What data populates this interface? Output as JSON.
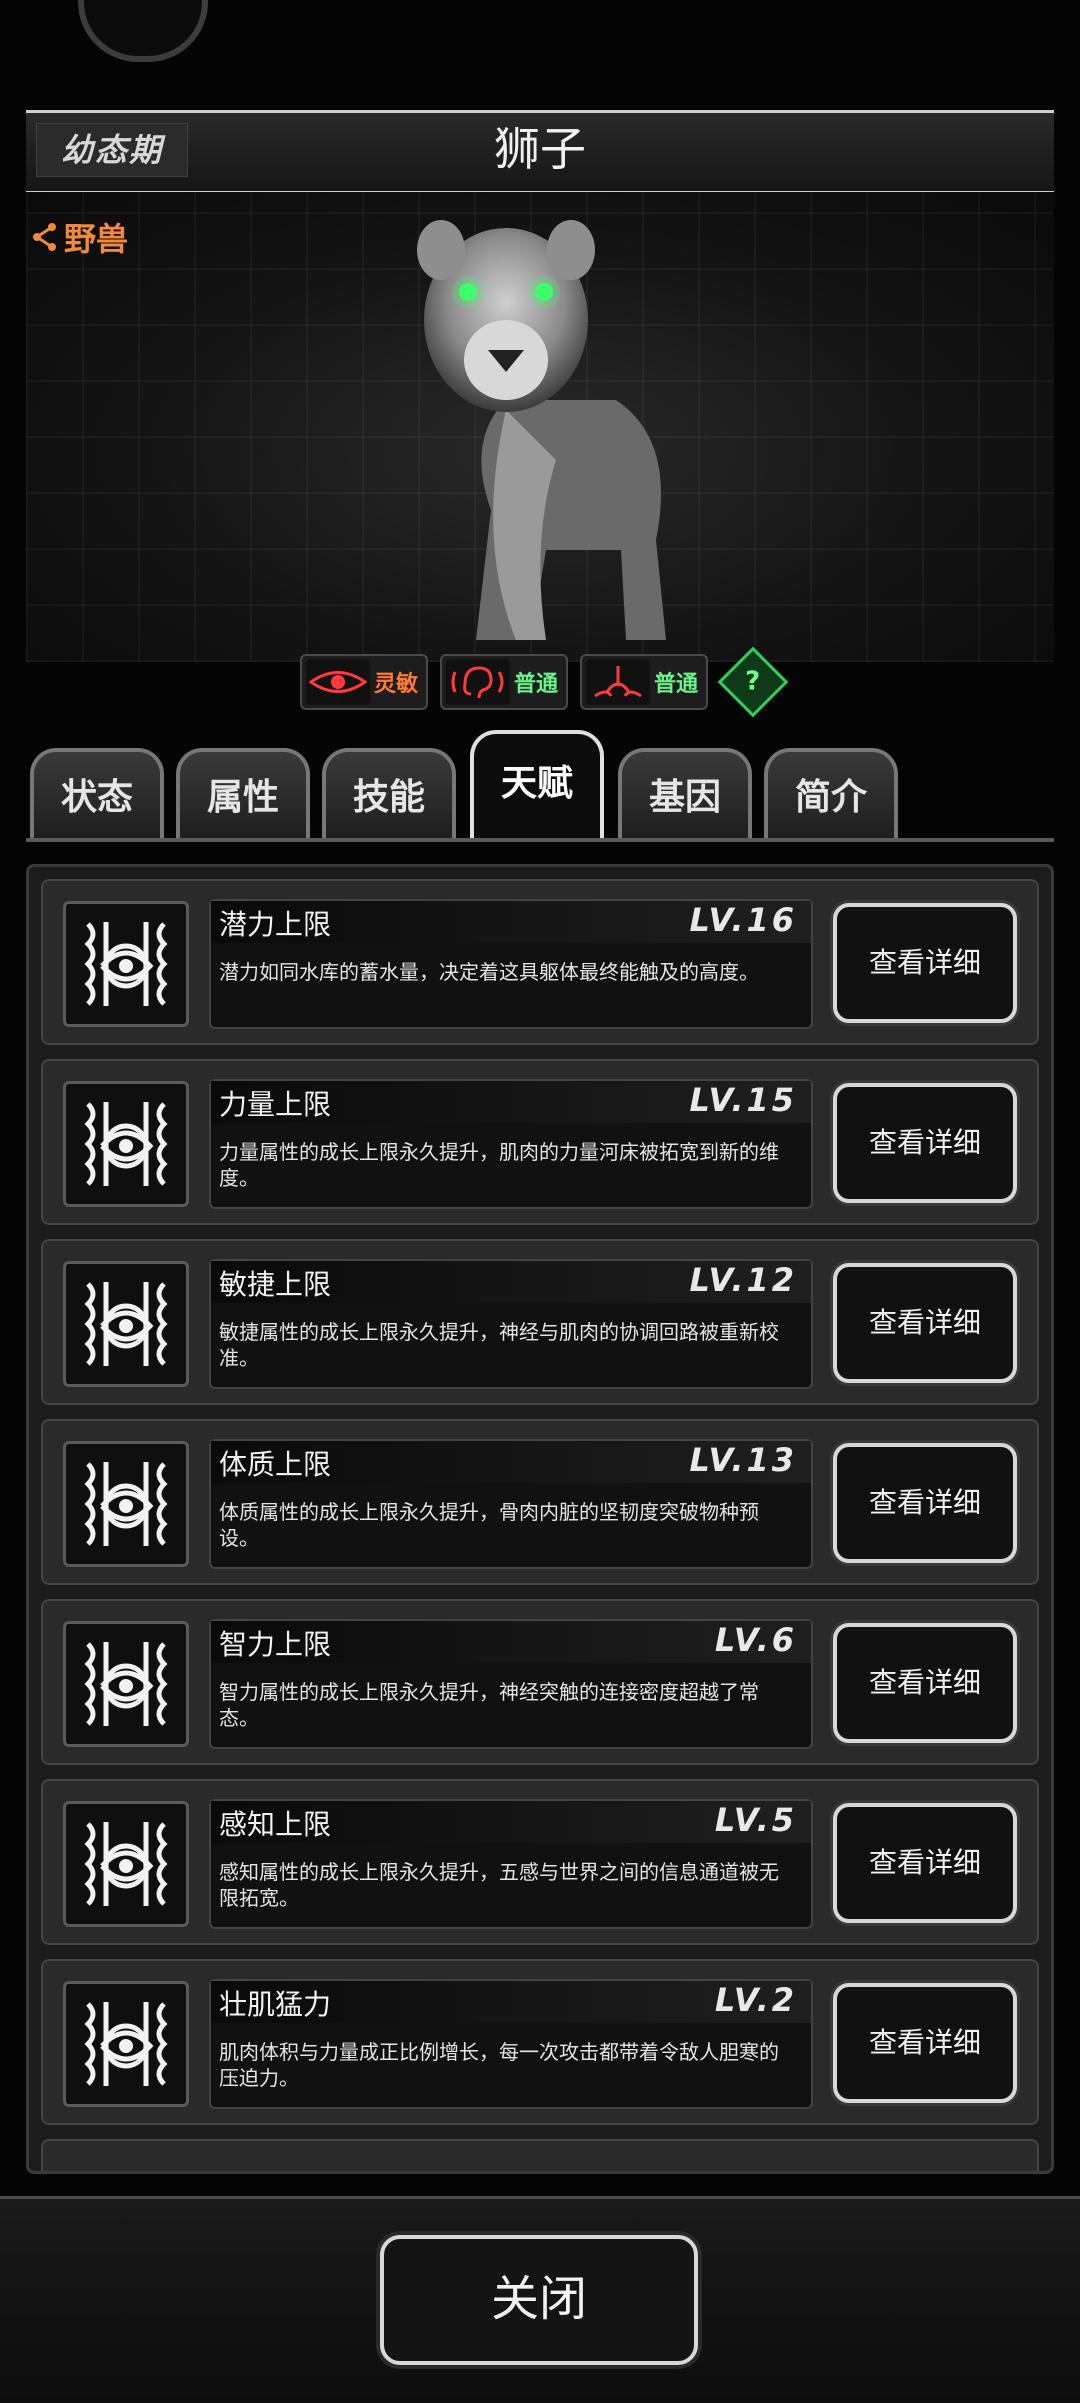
{
  "header": {
    "stage": "幼态期",
    "title": "狮子"
  },
  "creature": {
    "type_label": "野兽",
    "senses": [
      {
        "label": "灵敏",
        "icon": "eye-icon",
        "color": "#ff7a3a"
      },
      {
        "label": "普通",
        "icon": "ear-icon",
        "color": "#6cf08a"
      },
      {
        "label": "普通",
        "icon": "nose-icon",
        "color": "#6cf08a"
      }
    ],
    "help_symbol": "?"
  },
  "tabs": [
    {
      "label": "状态",
      "active": false
    },
    {
      "label": "属性",
      "active": false
    },
    {
      "label": "技能",
      "active": false
    },
    {
      "label": "天赋",
      "active": true
    },
    {
      "label": "基因",
      "active": false
    },
    {
      "label": "简介",
      "active": false
    }
  ],
  "talents": [
    {
      "name": "潜力上限",
      "level": "LV.16",
      "description": "潜力如同水库的蓄水量，决定着这具躯体最终能触及的高度。",
      "button": "查看详细"
    },
    {
      "name": "力量上限",
      "level": "LV.15",
      "description": "力量属性的成长上限永久提升，肌肉的力量河床被拓宽到新的维度。",
      "button": "查看详细"
    },
    {
      "name": "敏捷上限",
      "level": "LV.12",
      "description": "敏捷属性的成长上限永久提升，神经与肌肉的协调回路被重新校准。",
      "button": "查看详细"
    },
    {
      "name": "体质上限",
      "level": "LV.13",
      "description": "体质属性的成长上限永久提升，骨肉内脏的坚韧度突破物种预设。",
      "button": "查看详细"
    },
    {
      "name": "智力上限",
      "level": "LV.6",
      "description": "智力属性的成长上限永久提升，神经突触的连接密度超越了常态。",
      "button": "查看详细"
    },
    {
      "name": "感知上限",
      "level": "LV.5",
      "description": "感知属性的成长上限永久提升，五感与世界之间的信息通道被无限拓宽。",
      "button": "查看详细"
    },
    {
      "name": "壮肌猛力",
      "level": "LV.2",
      "description": "肌肉体积与力量成正比例增长，每一次攻击都带着令敌人胆寒的压迫力。",
      "button": "查看详细"
    }
  ],
  "close_label": "关闭"
}
